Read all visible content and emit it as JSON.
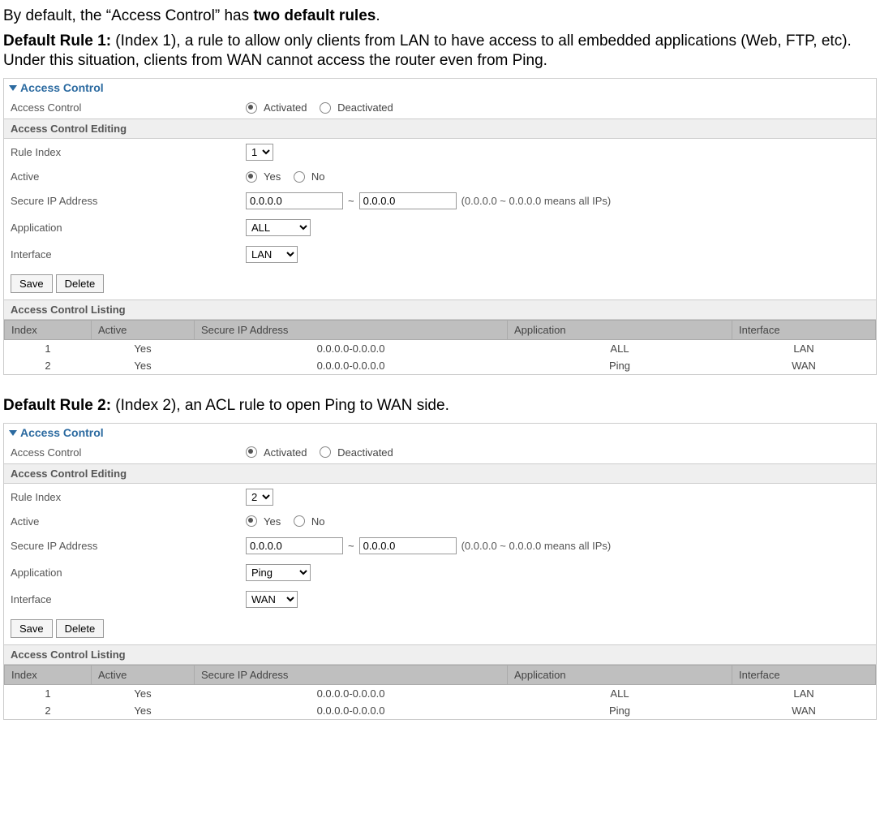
{
  "intro": {
    "line1_prefix": "By default, the “Access Control” has ",
    "line1_bold": "two default rules",
    "line1_suffix": ".",
    "rule1_label": "Default Rule 1:",
    "rule1_text": " (Index 1), a rule to allow only clients from LAN to have access to all embedded applications (Web, FTP, etc). Under this situation, clients from WAN cannot access the router even from Ping.",
    "rule2_label": "Default Rule 2:",
    "rule2_text": " (Index 2), an ACL rule to open Ping to WAN side."
  },
  "labels": {
    "panel_title": "Access Control",
    "access_control": "Access Control",
    "activated": "Activated",
    "deactivated": "Deactivated",
    "editing_head": "Access Control Editing",
    "rule_index": "Rule Index",
    "active": "Active",
    "yes": "Yes",
    "no": "No",
    "secure_ip": "Secure IP Address",
    "tilde": "~",
    "ip_hint": "(0.0.0.0 ~ 0.0.0.0 means all IPs)",
    "application": "Application",
    "interface": "Interface",
    "save": "Save",
    "delete": "Delete",
    "listing_head": "Access Control Listing",
    "col_index": "Index",
    "col_active": "Active",
    "col_secure_ip": "Secure IP Address",
    "col_application": "Application",
    "col_interface": "Interface"
  },
  "panel1": {
    "rule_index": "1",
    "ip_from": "0.0.0.0",
    "ip_to": "0.0.0.0",
    "application": "ALL",
    "interface": "LAN"
  },
  "panel2": {
    "rule_index": "2",
    "ip_from": "0.0.0.0",
    "ip_to": "0.0.0.0",
    "application": "Ping",
    "interface": "WAN"
  },
  "listing": [
    {
      "index": "1",
      "active": "Yes",
      "secure_ip": "0.0.0.0-0.0.0.0",
      "application": "ALL",
      "interface": "LAN"
    },
    {
      "index": "2",
      "active": "Yes",
      "secure_ip": "0.0.0.0-0.0.0.0",
      "application": "Ping",
      "interface": "WAN"
    }
  ]
}
